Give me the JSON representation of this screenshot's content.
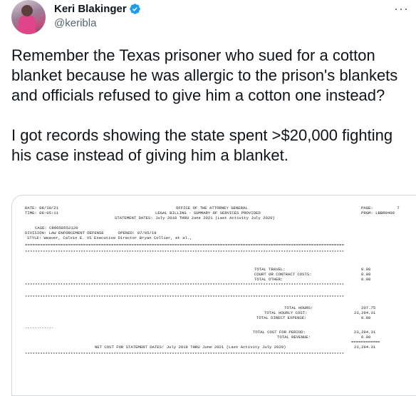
{
  "author": {
    "display_name": "Keri Blakinger",
    "handle": "@keribla",
    "more_icon": "more-dots-icon",
    "verified_color": "#1d9bf0"
  },
  "tweet": {
    "paragraph_1": "Remember the Texas prisoner who sued for a cotton blanket because he was allergic to the prison's blankets and officials refused to give him a cotton one instead?",
    "paragraph_2": "I got records showing the state spent >$20,000 fighting his case instead of giving him a blanket."
  },
  "document": {
    "date": "DATE: 08/10/21",
    "time": "TIME: 08:05:11",
    "office": "OFFICE OF THE ATTORNEY GENERAL",
    "legal_billing": "LEGAL BILLING - SUMMARY OF SERVICES PROVIDED",
    "statement_dates": "STATEMENT DATES: July 2018 THRU June 2021 (Last Activity July 2020)",
    "page": "PAGE:          7",
    "program": "PRGM: LBBR0400",
    "case": "CASE: CR9058552120",
    "division": "DIVISION: LAW ENFORCEMENT DEFENSE      OPENED: 07/05/18",
    "style": "STYLE: Weaver, Calvin E. VS Executive Director Bryan Collier, et al.,",
    "total_travel_label": "TOTAL TRAVEL:",
    "total_travel": "0.00",
    "court_costs_label": "COURT OR CONTRACT COSTS:",
    "court_costs": "0.00",
    "total_other_label": "TOTAL OTHER:",
    "total_other": "0.00",
    "total_hours_label": "TOTAL HOURS:",
    "total_hours": "207.75",
    "total_hourly_cost_label": "TOTAL HOURLY COST:",
    "total_hourly_cost": "23,294.31",
    "total_direct_expense_label": "TOTAL DIRECT EXPENSE:",
    "total_direct_expense": "0.00",
    "dash_line": "------------",
    "total_cost_period_label": "TOTAL COST FOR PERIOD:",
    "total_cost_period": "23,294.31",
    "total_revenue_label": "TOTAL REVENUE:",
    "total_revenue": "0.00",
    "equals_line": "============",
    "net_cost_label": "NET COST FOR STATEMENT DATES: July 2018 THRU June 2021 (Last Activity July 2020)",
    "net_cost": "23,294.31"
  }
}
